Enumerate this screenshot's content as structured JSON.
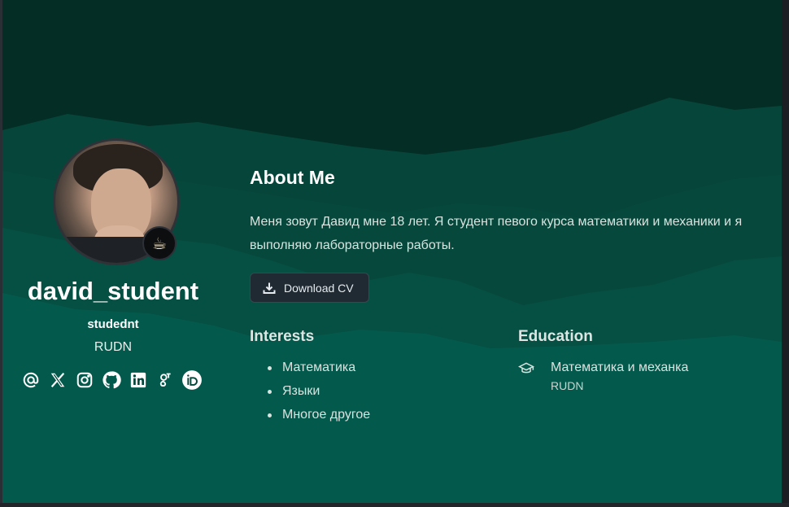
{
  "profile": {
    "username": "david_student",
    "nickname": "studednt",
    "organization": "RUDN",
    "avatar_badge_icon": "coffee-icon"
  },
  "socials": [
    {
      "icon": "email-icon"
    },
    {
      "icon": "x-icon"
    },
    {
      "icon": "instagram-icon"
    },
    {
      "icon": "github-icon"
    },
    {
      "icon": "linkedin-icon"
    },
    {
      "icon": "google-scholar-icon"
    },
    {
      "icon": "orcid-icon"
    }
  ],
  "about": {
    "title": "About Me",
    "text": "Меня зовут Давид мне 18 лет. Я студент певого курса математики и механики и я выполняю лабораторные работы.",
    "cv_button": "Download CV"
  },
  "interests": {
    "title": "Interests",
    "items": [
      "Математика",
      "Языки",
      "Многое другое"
    ]
  },
  "education": {
    "title": "Education",
    "items": [
      {
        "degree": "Математика и механка",
        "institution": "RUDN"
      }
    ]
  },
  "colors": {
    "background_dark": "#05362c",
    "wave_mid": "#0b4a3d",
    "wave_light": "#03564a",
    "button_bg": "#1f2a33",
    "text_primary": "#ffffff"
  }
}
